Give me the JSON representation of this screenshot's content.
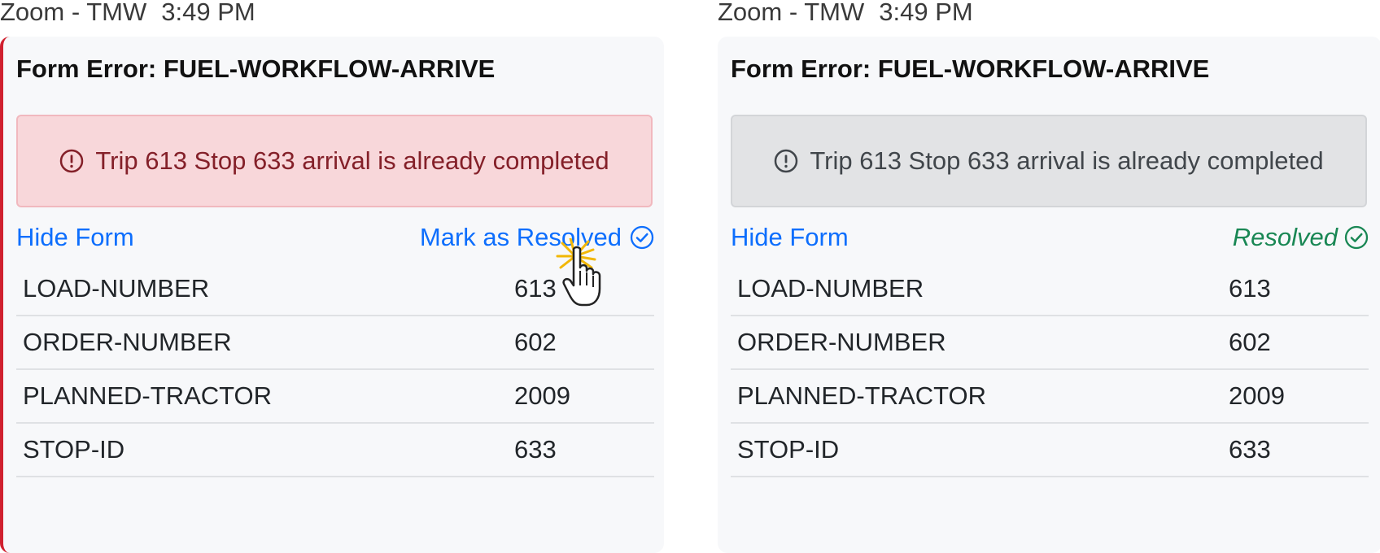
{
  "panels": [
    {
      "window_title": "Zoom - TMW",
      "time": "3:49 PM",
      "form_title": "Form Error: FUEL-WORKFLOW-ARRIVE",
      "alert_text": "Trip 613 Stop 633 arrival is already completed",
      "hide_form_label": "Hide Form",
      "action_label": "Mark as Resolved",
      "fields": [
        {
          "name": "LOAD-NUMBER",
          "value": "613"
        },
        {
          "name": "ORDER-NUMBER",
          "value": "602"
        },
        {
          "name": "PLANNED-TRACTOR",
          "value": "2009"
        },
        {
          "name": "STOP-ID",
          "value": "633"
        }
      ]
    },
    {
      "window_title": "Zoom - TMW",
      "time": "3:49 PM",
      "form_title": "Form Error: FUEL-WORKFLOW-ARRIVE",
      "alert_text": "Trip 613 Stop 633 arrival is already completed",
      "hide_form_label": "Hide Form",
      "status_label": "Resolved",
      "fields": [
        {
          "name": "LOAD-NUMBER",
          "value": "613"
        },
        {
          "name": "ORDER-NUMBER",
          "value": "602"
        },
        {
          "name": "PLANNED-TRACTOR",
          "value": "2009"
        },
        {
          "name": "STOP-ID",
          "value": "633"
        }
      ]
    }
  ],
  "colors": {
    "danger_alert_bg": "#f8d7da",
    "danger_alert_text": "#842029",
    "muted_alert_bg": "#e2e3e5",
    "link": "#0d6efd",
    "resolved": "#198754",
    "error_edge": "#d0202f"
  },
  "icons": [
    "alert-circle-icon",
    "check-circle-icon",
    "hand-pointer-cursor-icon"
  ]
}
